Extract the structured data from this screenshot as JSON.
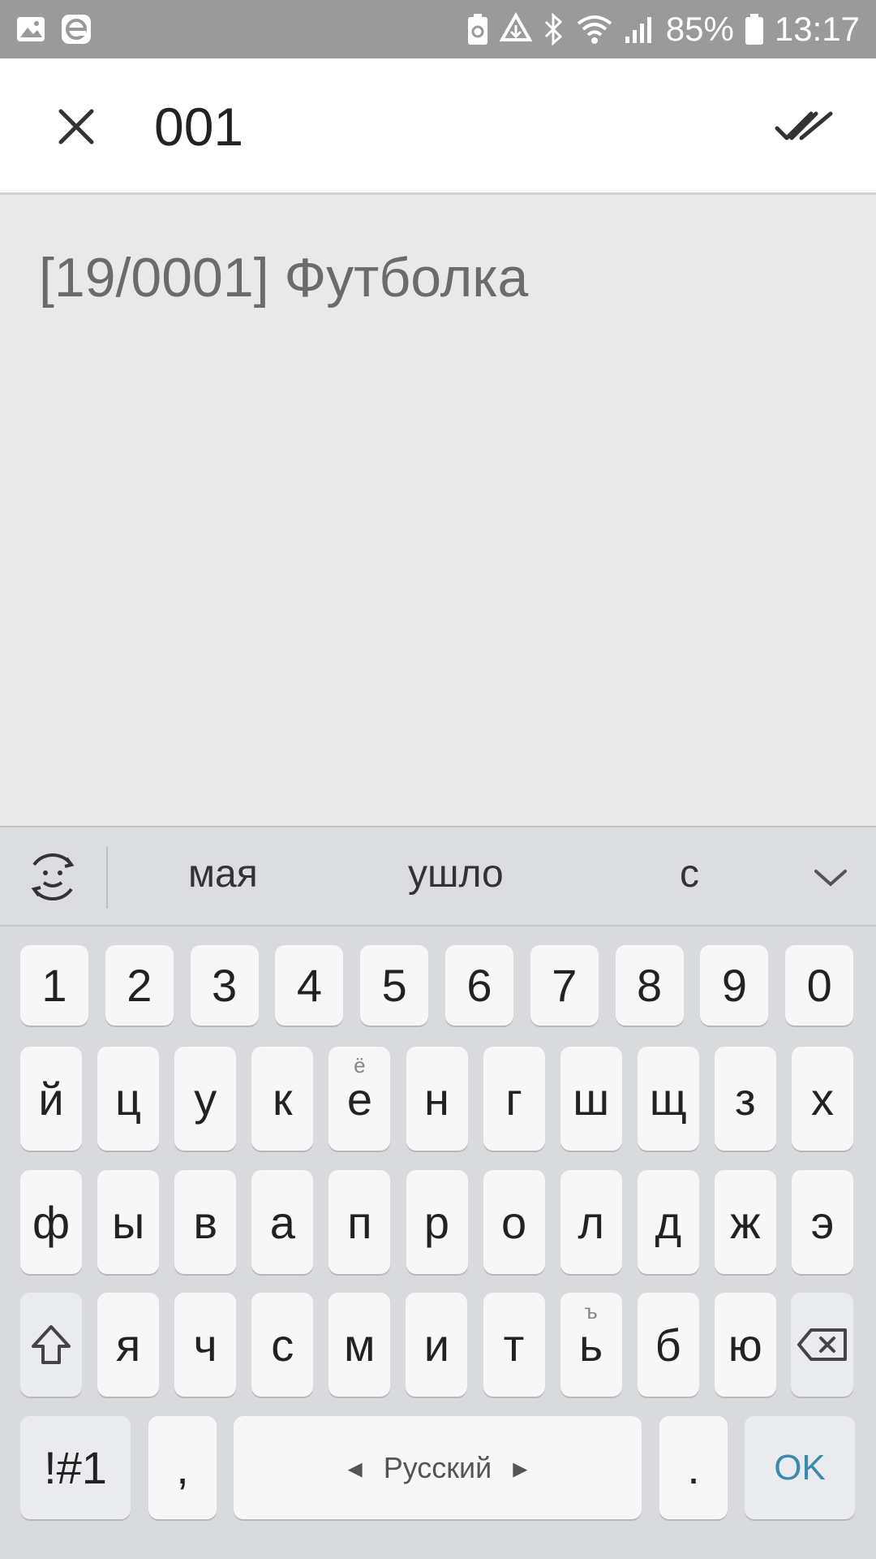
{
  "status_bar": {
    "battery_percent": "85%",
    "time": "13:17",
    "icons": [
      "gallery-icon",
      "edge-icon",
      "battery-saver-icon",
      "recycle-icon",
      "bluetooth-icon",
      "wifi-icon",
      "signal-icon",
      "battery-icon"
    ]
  },
  "header": {
    "search_value": "001"
  },
  "results": [
    {
      "label": "[19/0001] Футболка"
    }
  ],
  "keyboard": {
    "suggestions": [
      "мая",
      "ушло",
      "с"
    ],
    "row_numbers": [
      "1",
      "2",
      "3",
      "4",
      "5",
      "6",
      "7",
      "8",
      "9",
      "0"
    ],
    "row1": [
      {
        "label": "й",
        "hint": ""
      },
      {
        "label": "ц",
        "hint": ""
      },
      {
        "label": "у",
        "hint": ""
      },
      {
        "label": "к",
        "hint": ""
      },
      {
        "label": "е",
        "hint": "ё"
      },
      {
        "label": "н",
        "hint": ""
      },
      {
        "label": "г",
        "hint": ""
      },
      {
        "label": "ш",
        "hint": ""
      },
      {
        "label": "щ",
        "hint": ""
      },
      {
        "label": "з",
        "hint": ""
      },
      {
        "label": "х",
        "hint": ""
      }
    ],
    "row2": [
      "ф",
      "ы",
      "в",
      "а",
      "п",
      "р",
      "о",
      "л",
      "д",
      "ж",
      "э"
    ],
    "row3": [
      {
        "label": "я",
        "hint": ""
      },
      {
        "label": "ч",
        "hint": ""
      },
      {
        "label": "с",
        "hint": ""
      },
      {
        "label": "м",
        "hint": ""
      },
      {
        "label": "и",
        "hint": ""
      },
      {
        "label": "т",
        "hint": ""
      },
      {
        "label": "ь",
        "hint": "ъ"
      },
      {
        "label": "б",
        "hint": ""
      },
      {
        "label": "ю",
        "hint": ""
      }
    ],
    "symbols_label": "!#1",
    "comma_label": ",",
    "space_label": "Русский",
    "period_label": ".",
    "ok_label": "OK",
    "colors": {
      "ok": "#3b8ab0",
      "key_bg": "#f7f7f7",
      "keyboard_bg": "#d9dade"
    }
  }
}
